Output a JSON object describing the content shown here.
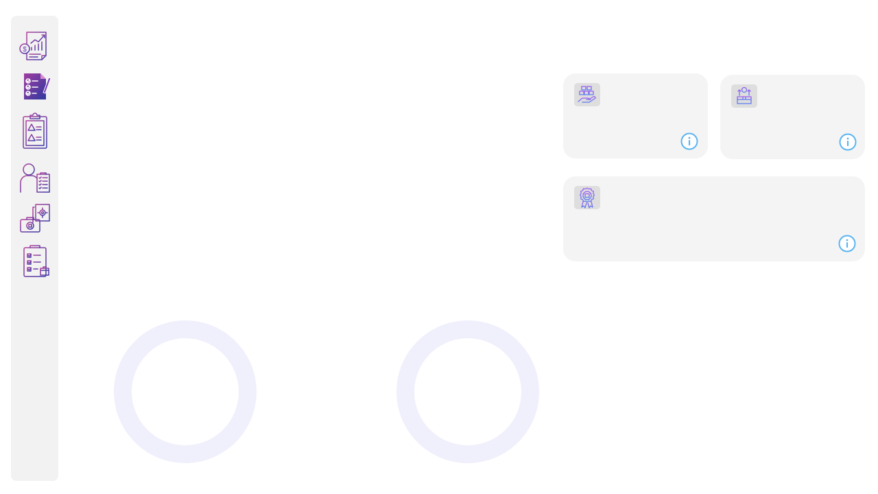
{
  "sidebar": {
    "items": [
      {
        "icon": "financial-report-icon"
      },
      {
        "icon": "checklist-edit-icon"
      },
      {
        "icon": "risk-clipboard-icon"
      },
      {
        "icon": "employee-checklist-icon"
      },
      {
        "icon": "toolbox-settings-icon"
      },
      {
        "icon": "inventory-checklist-icon"
      }
    ]
  },
  "cards": [
    {
      "icon": "boxes-in-hand-icon",
      "info_icon": "info-icon"
    },
    {
      "icon": "product-growth-icon",
      "info_icon": "info-icon"
    },
    {
      "icon": "quality-badge-icon",
      "info_icon": "info-icon"
    }
  ],
  "gauges": [
    {
      "ring_color": "#f0f0fc"
    },
    {
      "ring_color": "#f0f0fc"
    }
  ],
  "colors": {
    "accent_purple": "#6a3fb5",
    "accent_magenta": "#a0409a",
    "info_blue": "#5ab4f0",
    "card_bg": "#f4f4f4",
    "sidebar_bg": "#f2f2f2"
  }
}
